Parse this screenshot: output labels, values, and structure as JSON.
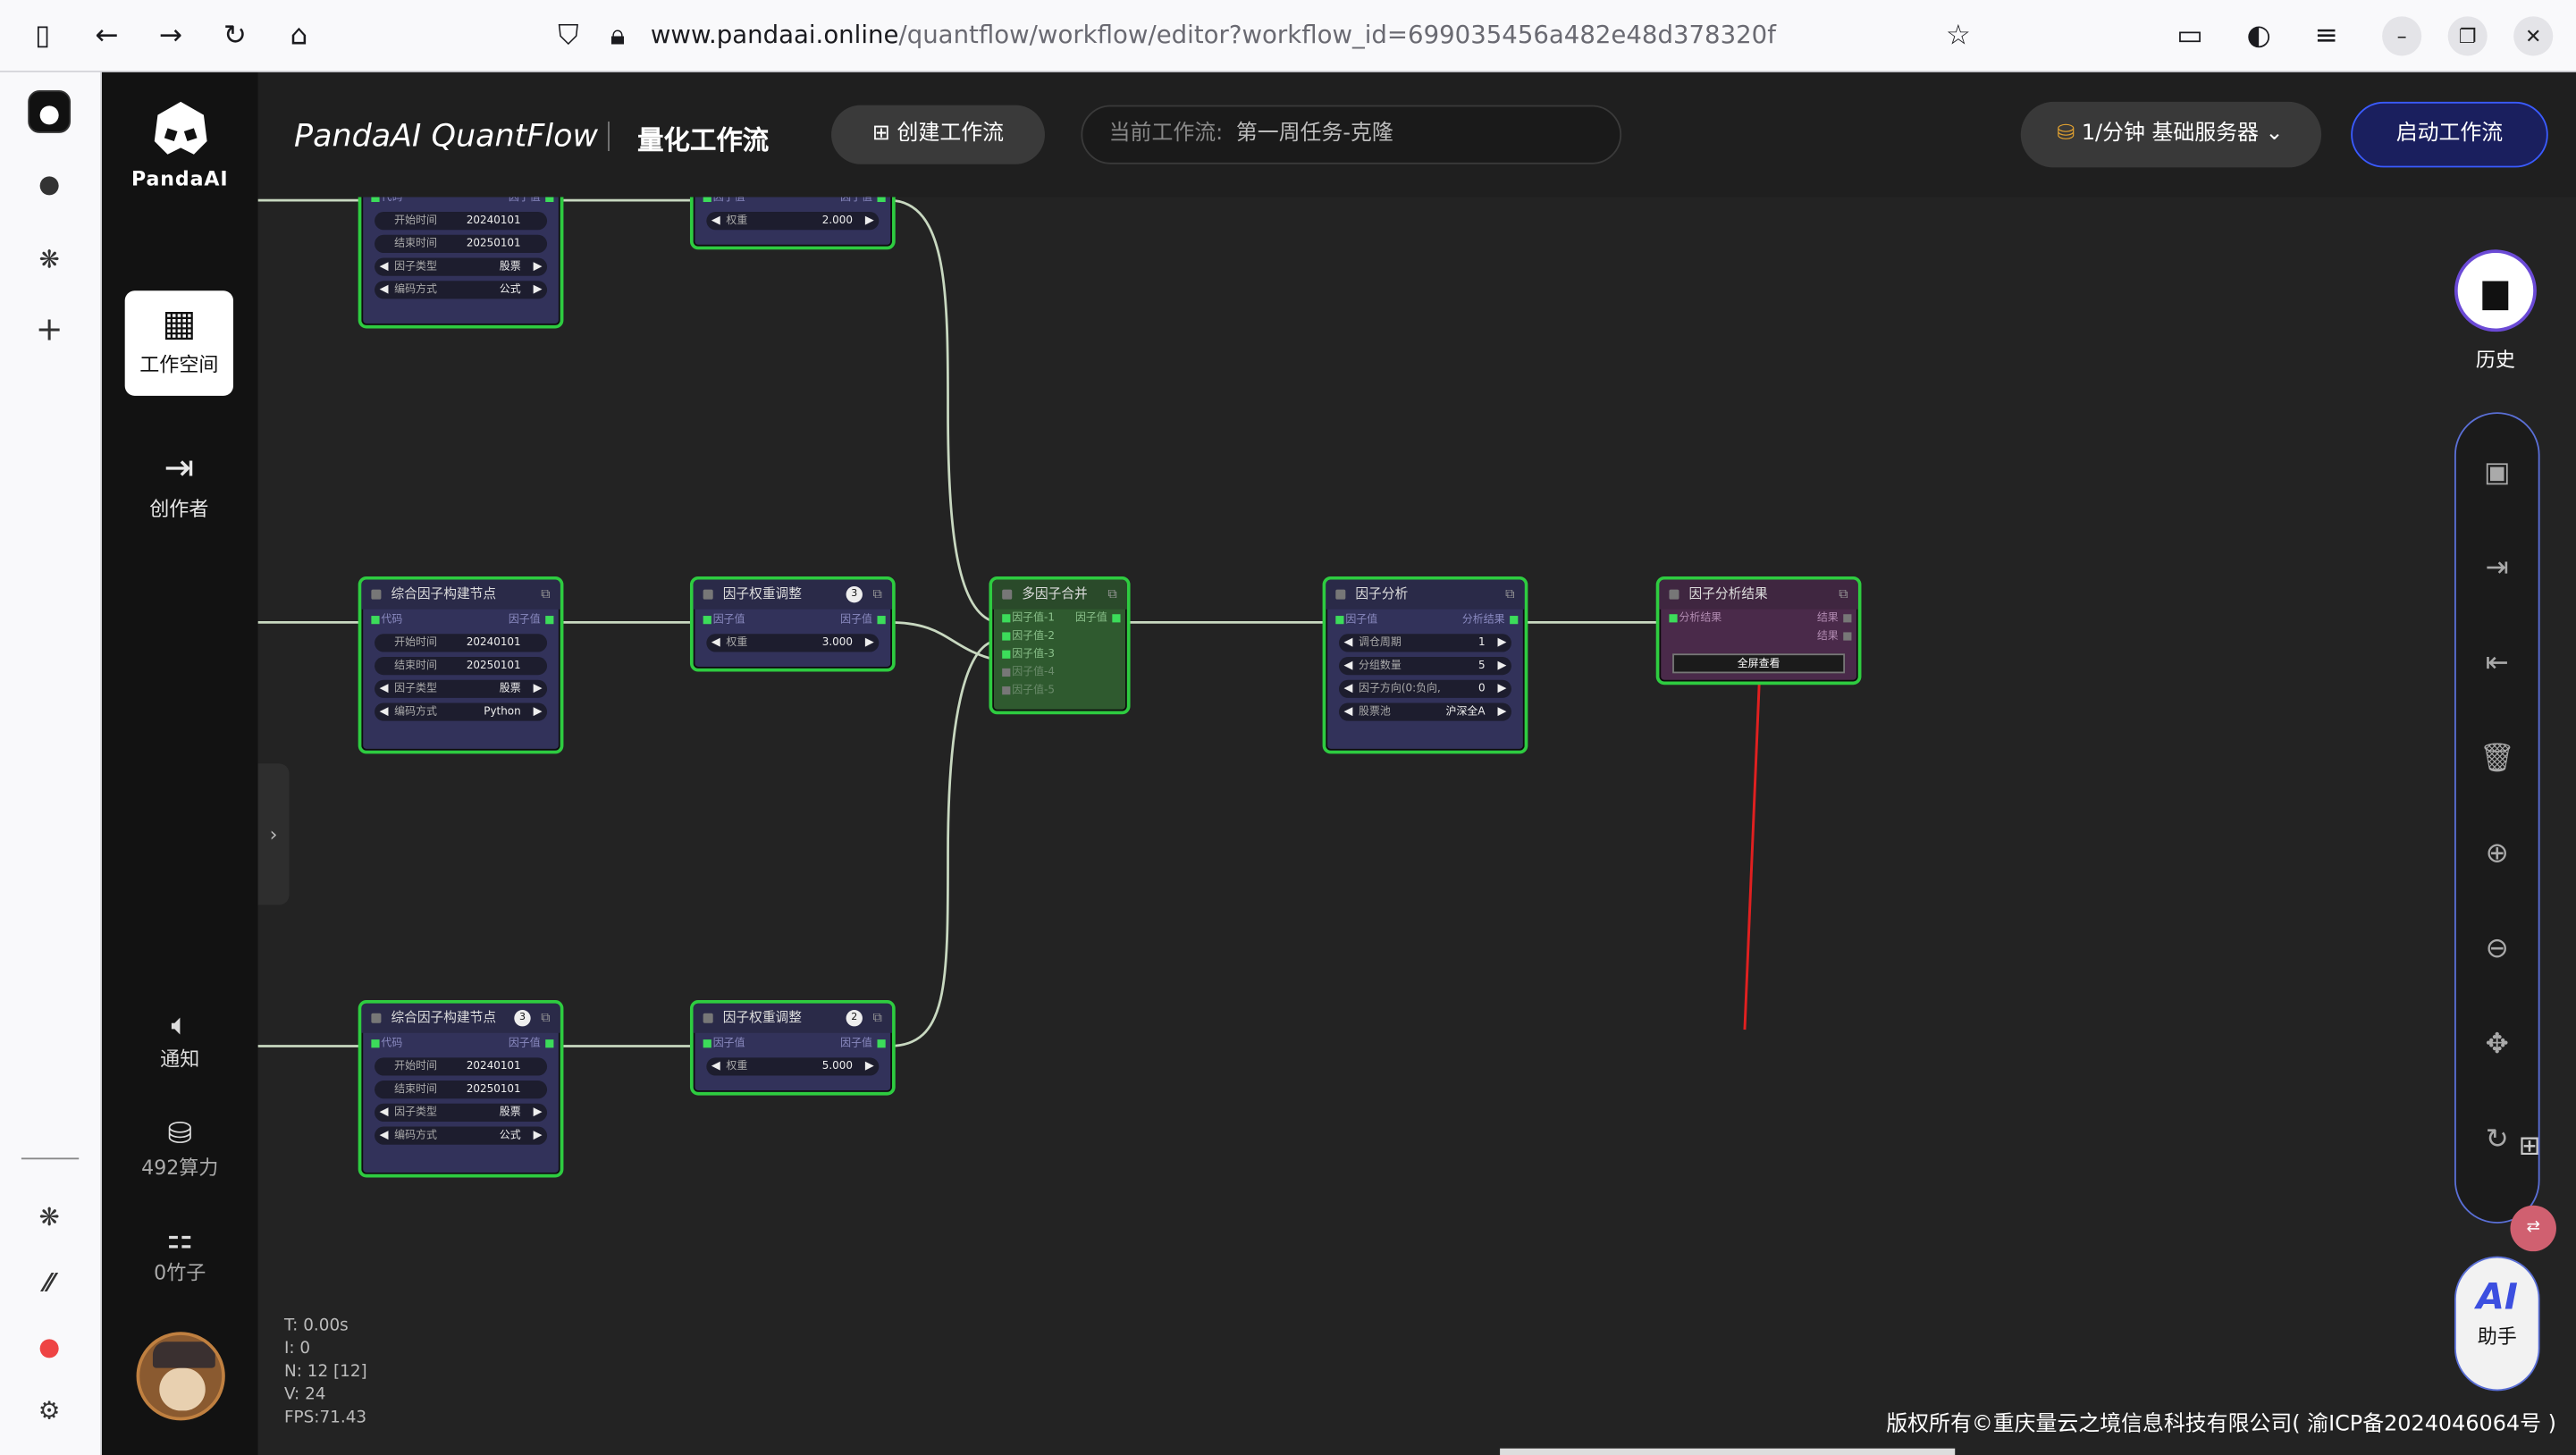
{
  "browser": {
    "url_host": "www.pandaai.online",
    "url_rest": "/quantflow/workflow/editor?workflow_id=699035456a482e48d378320f"
  },
  "sidebar": {
    "logo": "PandaAI",
    "workspace": "工作空间",
    "creator": "创作者",
    "notice": "通知",
    "compute": "492算力",
    "bamboo": "0竹子"
  },
  "header": {
    "brand": "PandaAI QuantFlow",
    "subtitle": "量化工作流",
    "create_btn": "创建工作流",
    "current_label": "当前工作流:",
    "current_value": "第一周任务-克隆",
    "server_label": "1/分钟  基础服务器",
    "start_btn": "启动工作流"
  },
  "nodes": {
    "f1": {
      "out_l": "代码",
      "out_r": "因子值",
      "start_l": "开始时间",
      "start_v": "20240101",
      "end_l": "结束时间",
      "end_v": "20250101",
      "type_l": "因子类型",
      "type_v": "股票",
      "mode_l": "编码方式",
      "mode_v": "公式"
    },
    "w1": {
      "in_l": "因子值",
      "in_r": "因子值",
      "wt_l": "权重",
      "wt_v": "2.000"
    },
    "f2": {
      "title": "综合因子构建节点",
      "out_l": "代码",
      "out_r": "因子值",
      "start_l": "开始时间",
      "start_v": "20240101",
      "end_l": "结束时间",
      "end_v": "20250101",
      "type_l": "因子类型",
      "type_v": "股票",
      "mode_l": "编码方式",
      "mode_v": "Python"
    },
    "w2": {
      "title": "因子权重调整",
      "badge": "3",
      "in_l": "因子值",
      "in_r": "因子值",
      "wt_l": "权重",
      "wt_v": "3.000"
    },
    "merge": {
      "title": "多因子合并",
      "p1": "因子值-1",
      "out": "因子值",
      "p2": "因子值-2",
      "p3": "因子值-3",
      "p4": "因子值-4",
      "p5": "因子值-5"
    },
    "analysis": {
      "title": "因子分析",
      "in_l": "因子值",
      "out_r": "分析结果",
      "period_l": "调仓周期",
      "period_v": "1",
      "group_l": "分组数量",
      "group_v": "5",
      "dir_l": "因子方向(0:负向,",
      "dir_v": "0",
      "pool_l": "股票池",
      "pool_v": "沪深全A"
    },
    "result": {
      "title": "因子分析结果",
      "in_l": "分析结果",
      "out1": "结果",
      "out2": "结果",
      "btn": "全屏查看"
    },
    "f3": {
      "title": "综合因子构建节点",
      "badge": "3",
      "out_l": "代码",
      "out_r": "因子值",
      "start_l": "开始时间",
      "start_v": "20240101",
      "end_l": "结束时间",
      "end_v": "20250101",
      "type_l": "因子类型",
      "type_v": "股票",
      "mode_l": "编码方式",
      "mode_v": "公式"
    },
    "w3": {
      "title": "因子权重调整",
      "badge": "2",
      "in_l": "因子值",
      "in_r": "因子值",
      "wt_l": "权重",
      "wt_v": "5.000"
    }
  },
  "tools": {
    "history": "历史",
    "assistant_logo": "AI",
    "assistant": "助手",
    "translate_icon": "translate-icon"
  },
  "stats": {
    "t": "T: 0.00s",
    "i": "I: 0",
    "n": "N: 12 [12]",
    "v": "V: 24",
    "fps": "FPS:71.43"
  },
  "footer": "版权所有©重庆量云之境信息科技有限公司( 渝ICP备2024046064号 )",
  "colors": {
    "node_border": "#2ecc40",
    "accent": "#3a5bff",
    "wire": "#c8d8c0",
    "annotation": "#e02020"
  }
}
